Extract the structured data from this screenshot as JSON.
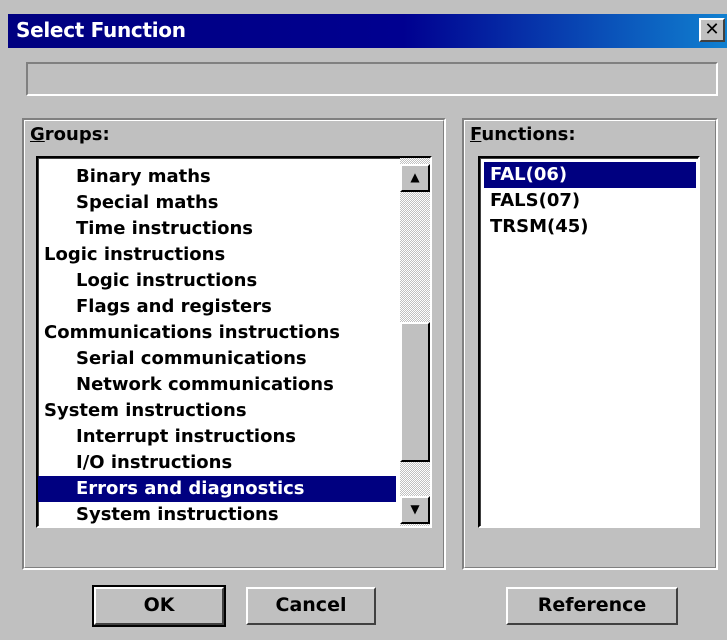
{
  "window": {
    "title": "Select Function",
    "close_glyph": "✕",
    "status_text": ""
  },
  "groups": {
    "label_accel": "G",
    "label_rest": "roups:",
    "items": [
      {
        "label": "Binary maths",
        "indent": 1,
        "selected": false
      },
      {
        "label": "Special maths",
        "indent": 1,
        "selected": false
      },
      {
        "label": "Time instructions",
        "indent": 1,
        "selected": false
      },
      {
        "label": "Logic instructions",
        "indent": 0,
        "selected": false
      },
      {
        "label": "Logic instructions",
        "indent": 1,
        "selected": false
      },
      {
        "label": "Flags and registers",
        "indent": 1,
        "selected": false
      },
      {
        "label": "Communications instructions",
        "indent": 0,
        "selected": false
      },
      {
        "label": "Serial communications",
        "indent": 1,
        "selected": false
      },
      {
        "label": "Network communications",
        "indent": 1,
        "selected": false
      },
      {
        "label": "System instructions",
        "indent": 0,
        "selected": false
      },
      {
        "label": "Interrupt instructions",
        "indent": 1,
        "selected": false
      },
      {
        "label": "I/O instructions",
        "indent": 1,
        "selected": false
      },
      {
        "label": "Errors and diagnostics",
        "indent": 1,
        "selected": true
      },
      {
        "label": "System instructions",
        "indent": 1,
        "selected": false
      }
    ],
    "scroll_up_glyph": "▲",
    "scroll_down_glyph": "▼"
  },
  "functions": {
    "label_accel": "F",
    "label_rest": "unctions:",
    "items": [
      {
        "label": "FAL(06)",
        "selected": true
      },
      {
        "label": "FALS(07)",
        "selected": false
      },
      {
        "label": "TRSM(45)",
        "selected": false
      }
    ]
  },
  "buttons": {
    "ok": "OK",
    "cancel": "Cancel",
    "reference": "Reference"
  },
  "colors": {
    "selection": "#000080",
    "face": "#c0c0c0"
  }
}
